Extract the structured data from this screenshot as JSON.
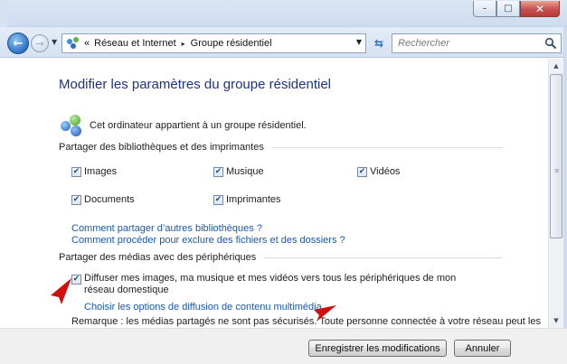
{
  "window": {
    "buttons": {
      "minimize_glyph": "–",
      "maximize_glyph": "□",
      "close_glyph": "✕"
    }
  },
  "nav": {
    "back_glyph": "←",
    "forward_glyph": "→",
    "breadcrumb_prefix": "«",
    "breadcrumbs": [
      "Réseau et Internet",
      "Groupe résidentiel"
    ],
    "separator_glyph": "▸",
    "dropdown_glyph": "▼",
    "refresh_glyph": "⇆",
    "search_placeholder": "Rechercher"
  },
  "main": {
    "title": "Modifier les paramètres du groupe résidentiel",
    "homegroup_status": "Cet ordinateur appartient à un groupe résidentiel.",
    "share_libraries_heading": "Partager des bibliothèques et des imprimantes",
    "libraries": [
      {
        "label": "Images",
        "checked": true
      },
      {
        "label": "Musique",
        "checked": true
      },
      {
        "label": "Vidéos",
        "checked": true
      },
      {
        "label": "Documents",
        "checked": true
      },
      {
        "label": "Imprimantes",
        "checked": true
      }
    ],
    "check_glyph": "✔",
    "links": [
      "Comment partager d’autres bibliothèques ?",
      "Comment procéder pour exclure des fichiers et des dossiers ?"
    ],
    "share_media_heading": "Partager des médias avec des périphériques",
    "media_option": {
      "label": "Diffuser mes images, ma musique et mes vidéos vers tous les périphériques de mon réseau domestique",
      "checked": true
    },
    "media_link": "Choisir les options de diffusion de contenu multimédia...",
    "remark": "Remarque : les médias partagés ne sont pas sécurisés. Toute personne connectée à votre réseau peut les"
  },
  "footer": {
    "save_label": "Enregistrer les modifications",
    "cancel_label": "Annuler"
  },
  "colors": {
    "title": "#1e3287",
    "link": "#1a56b8",
    "annotation_arrow": "#d10f0f"
  },
  "scrollbar": {
    "up_glyph": "▲",
    "down_glyph": "▼",
    "grip_glyph": "≡"
  }
}
